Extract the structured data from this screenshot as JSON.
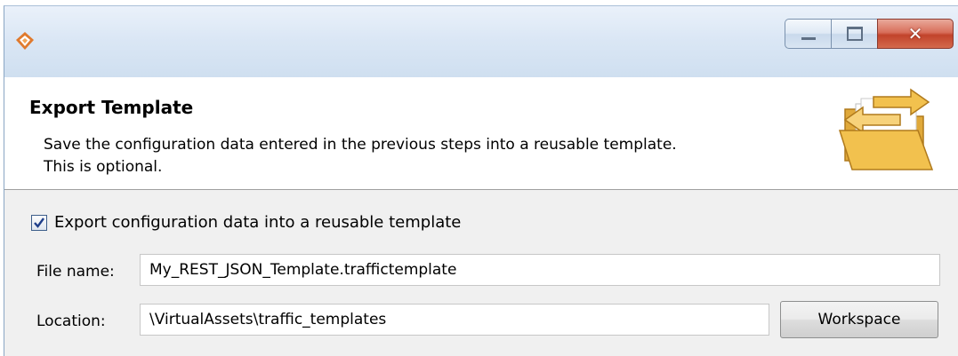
{
  "window": {
    "title": ""
  },
  "header": {
    "title": "Export Template",
    "description_line1": "Save the configuration data entered in the previous steps into a reusable template.",
    "description_line2": "This is optional."
  },
  "export_option": {
    "label": "Export configuration data into a reusable template",
    "checked": true
  },
  "file_name": {
    "label": "File name:",
    "value": "My_REST_JSON_Template.traffictemplate"
  },
  "location": {
    "label": "Location:",
    "value": "\\VirtualAssets\\traffic_templates",
    "workspace_button": "Workspace"
  },
  "colors": {
    "title_bar": "#dbe7f5",
    "close_button": "#c2432b",
    "folder": "#f2c14e",
    "body_background": "#f0f0f0"
  }
}
